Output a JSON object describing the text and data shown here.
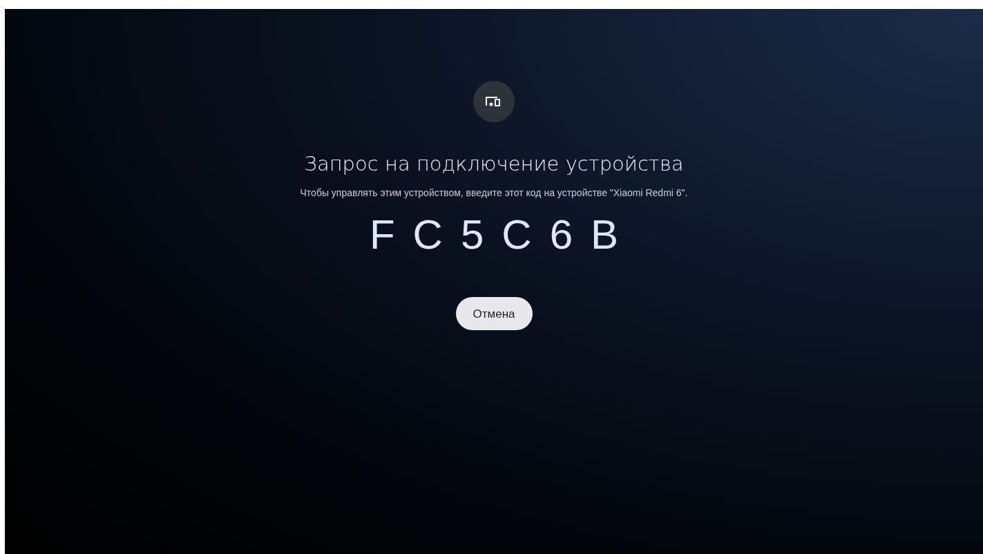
{
  "dialog": {
    "title": "Запрос на подключение устройства",
    "message": "Чтобы управлять этим устройством, введите этот код на устройстве \"Xiaomi Redmi 6\".",
    "code": [
      "F",
      "C",
      "5",
      "C",
      "6",
      "B"
    ],
    "buttons": [
      "Отмена"
    ]
  }
}
